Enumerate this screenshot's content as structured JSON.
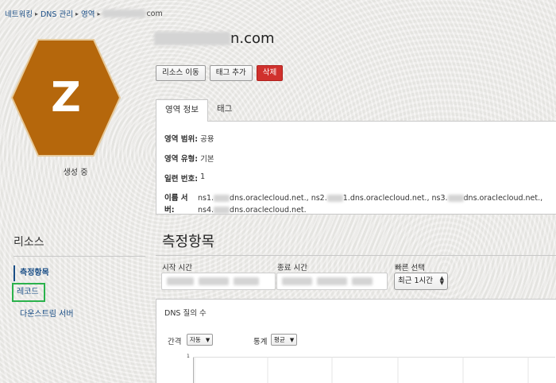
{
  "breadcrumb": {
    "items": [
      "네트워킹",
      "DNS 관리",
      "영역"
    ],
    "current_suffix": "com"
  },
  "zone": {
    "letter": "Z",
    "status": "생성 중",
    "title_suffix": "n.com",
    "hex_color": "#b5670c"
  },
  "actions": {
    "move_label": "리소스 이동",
    "tag_label": "태그 추가",
    "delete_label": "삭제"
  },
  "tabs": [
    {
      "label": "영역 정보",
      "active": true
    },
    {
      "label": "태그",
      "active": false
    }
  ],
  "info": {
    "scope_label": "영역 범위:",
    "scope_value": "공용",
    "type_label": "영역 유형:",
    "type_value": "기본",
    "serial_label": "일련 번호:",
    "serial_value": "1",
    "ns_label": "이름 서버:",
    "ns_line1_a": "ns1.",
    "ns_line1_b": "dns.oraclecloud.net., ns2.",
    "ns_line1_c": "1.dns.oraclecloud.net., ns3.",
    "ns_line1_d": "dns.oraclecloud.net.,",
    "ns_line2_a": "ns4.",
    "ns_line2_b": "dns.oraclecloud.net."
  },
  "resources": {
    "title": "리소스",
    "items": [
      {
        "label": "측정항목",
        "active": true
      },
      {
        "label": "레코드",
        "active": false
      },
      {
        "label": "다운스트림 서버",
        "active": false
      }
    ]
  },
  "metrics": {
    "title": "측정항목",
    "start_label": "시작 시간",
    "end_label": "종료 시간",
    "quick_label": "빠른 선택",
    "quick_value": "최근 1시간"
  },
  "chart_panel": {
    "title": "DNS 질의 수",
    "interval_label": "간격",
    "interval_value": "자동",
    "stat_label": "통계",
    "stat_value": "평균",
    "y_tick_top": "1"
  },
  "colors": {
    "accent": "#1a4e86",
    "danger": "#d0312d",
    "highlight": "#2bb24c"
  }
}
